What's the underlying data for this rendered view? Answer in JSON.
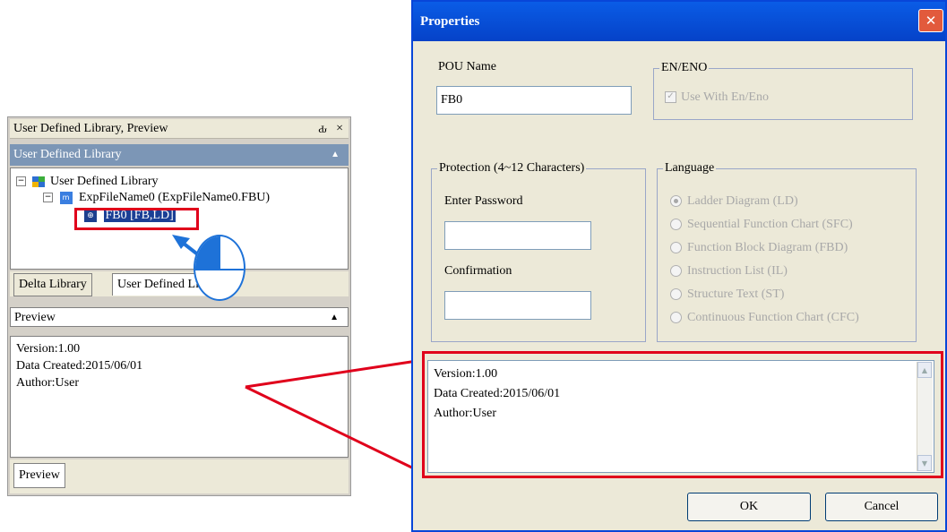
{
  "library_panel": {
    "title": "User Defined Library, Preview",
    "pin_icon": "Ԃ",
    "close_icon": "×",
    "section_title": "User Defined Library",
    "tree": {
      "root": "User Defined Library",
      "file": "ExpFileName0 (ExpFileName0.FBU)",
      "item": "FB0 [FB,LD]"
    },
    "tabs": [
      "Delta Library",
      "User Defined Library"
    ],
    "preview_head": "Preview",
    "preview_lines": [
      "Version:1.00",
      "Data Created:2015/06/01",
      "Author:User"
    ],
    "bottom_tab": "Preview"
  },
  "dialog": {
    "title": "Properties",
    "close_icon": "✕",
    "pou_label": "POU Name",
    "pou_value": "FB0",
    "en_eno_legend": "EN/ENO",
    "en_eno_checkbox": "Use With En/Eno",
    "protection_legend": "Protection (4~12 Characters)",
    "enter_password_label": "Enter Password",
    "confirmation_label": "Confirmation",
    "language_legend": "Language",
    "languages": [
      "Ladder Diagram (LD)",
      "Sequential Function Chart (SFC)",
      "Function Block Diagram (FBD)",
      "Instruction List (IL)",
      "Structure Text (ST)",
      "Continuous Function Chart (CFC)"
    ],
    "selected_language": "Ladder Diagram (LD)",
    "preview_lines": [
      "Version:1.00",
      "Data Created:2015/06/01",
      "Author:User"
    ],
    "ok_label": "OK",
    "cancel_label": "Cancel"
  },
  "colors": {
    "highlight": "#e0001b",
    "titlebar": "#0a5ce6",
    "arrow": "#1e72d8"
  }
}
